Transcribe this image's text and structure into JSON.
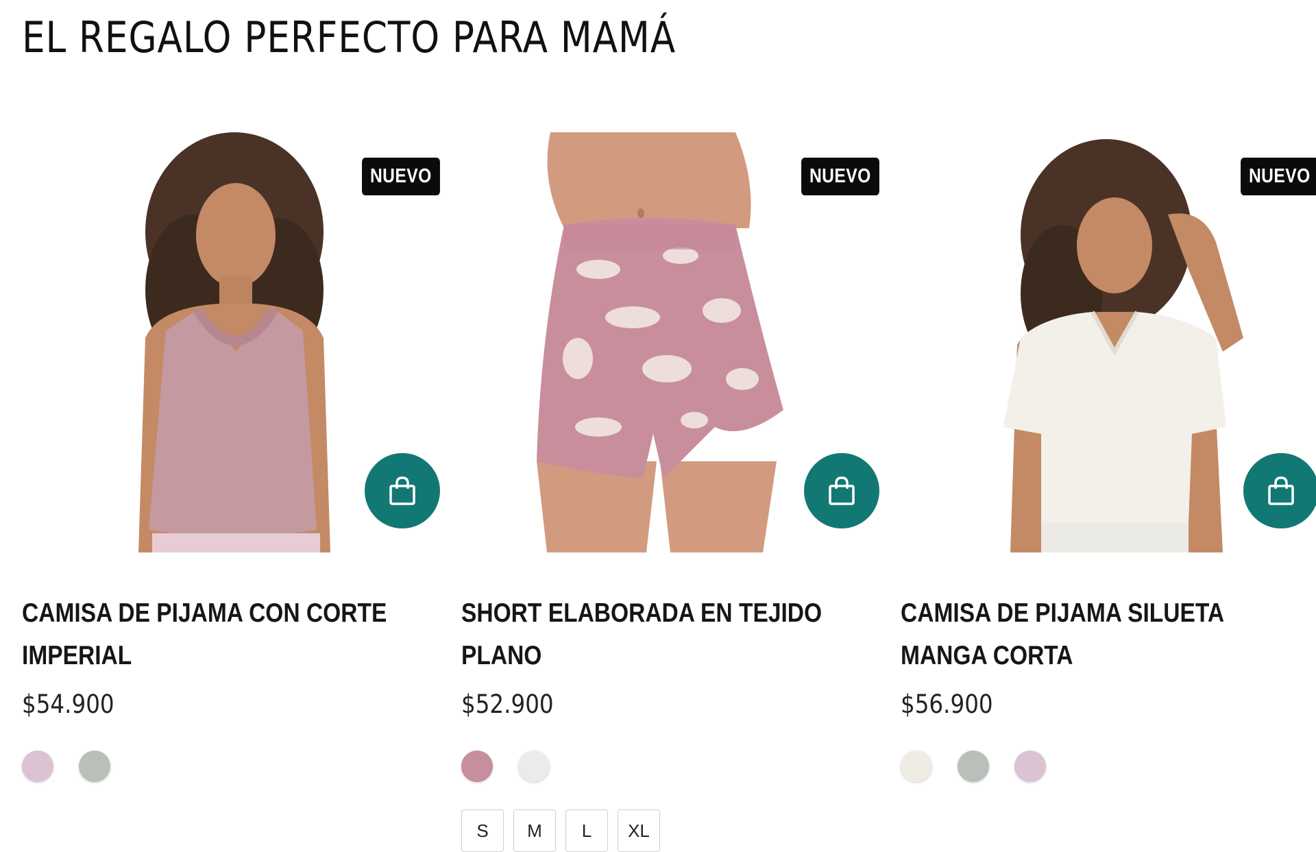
{
  "page": {
    "title": "EL REGALO PERFECTO PARA MAMÁ"
  },
  "products": [
    {
      "badge": "NUEVO",
      "name": "CAMISA DE PIJAMA CON CORTE IMPERIAL",
      "price": "$54.900",
      "cart_icon": "shopping-bag-icon",
      "swatches": [
        "#dcc3d3",
        "#b9c0b9"
      ]
    },
    {
      "badge": "NUEVO",
      "name": "SHORT ELABORADA EN TEJIDO PLANO",
      "price": "$52.900",
      "cart_icon": "shopping-bag-icon",
      "swatches": [
        "#c78e9d",
        "#ebebeb"
      ],
      "sizes": [
        "S",
        "M",
        "L",
        "XL"
      ]
    },
    {
      "badge": "NUEVO",
      "name": "CAMISA DE PIJAMA SILUETA MANGA CORTA",
      "price": "$56.900",
      "cart_icon": "shopping-bag-icon",
      "swatches": [
        "#efece3",
        "#b9c0b9",
        "#dcc3d3"
      ]
    }
  ],
  "colors": {
    "badge_bg": "#0b0b0b",
    "cart_button": "#127874"
  }
}
